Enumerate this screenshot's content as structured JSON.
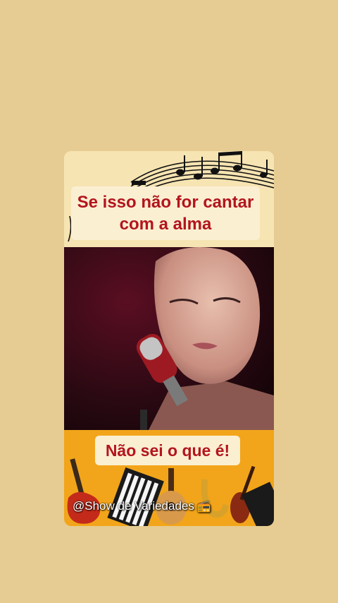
{
  "headline": "Se isso não for cantar com a alma",
  "headline_line1": "Se isso não for cantar",
  "headline_line2": "com a alma",
  "answer_text": "Não sei o que é!",
  "watermark_text": "@Show de Variedades",
  "colors": {
    "page_background": "#e6cc92",
    "caption_text": "#b3151d",
    "caption_box": "#fbefd2",
    "instrument_banner": "#f2a51a"
  },
  "icons": {
    "watermark": "radio-icon"
  }
}
